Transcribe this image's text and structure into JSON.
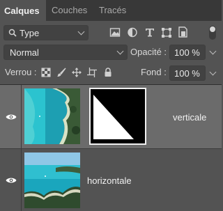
{
  "tabs": [
    {
      "label": "Calques"
    },
    {
      "label": "Couches"
    },
    {
      "label": "Tracés"
    }
  ],
  "filter": {
    "value": "Type"
  },
  "blend_mode": {
    "value": "Normal"
  },
  "opacity": {
    "label": "Opacité :",
    "value": "100 %"
  },
  "lock": {
    "label": "Verrou :"
  },
  "fill": {
    "label": "Fond :",
    "value": "100 %"
  },
  "layers": [
    {
      "name": "verticale",
      "selected": true
    },
    {
      "name": "horizontale",
      "selected": false
    }
  ],
  "colors": {
    "panel": "#535353",
    "tabbar": "#383838",
    "selected_layer": "#6b6b6b",
    "water": "#1fb3c4"
  }
}
